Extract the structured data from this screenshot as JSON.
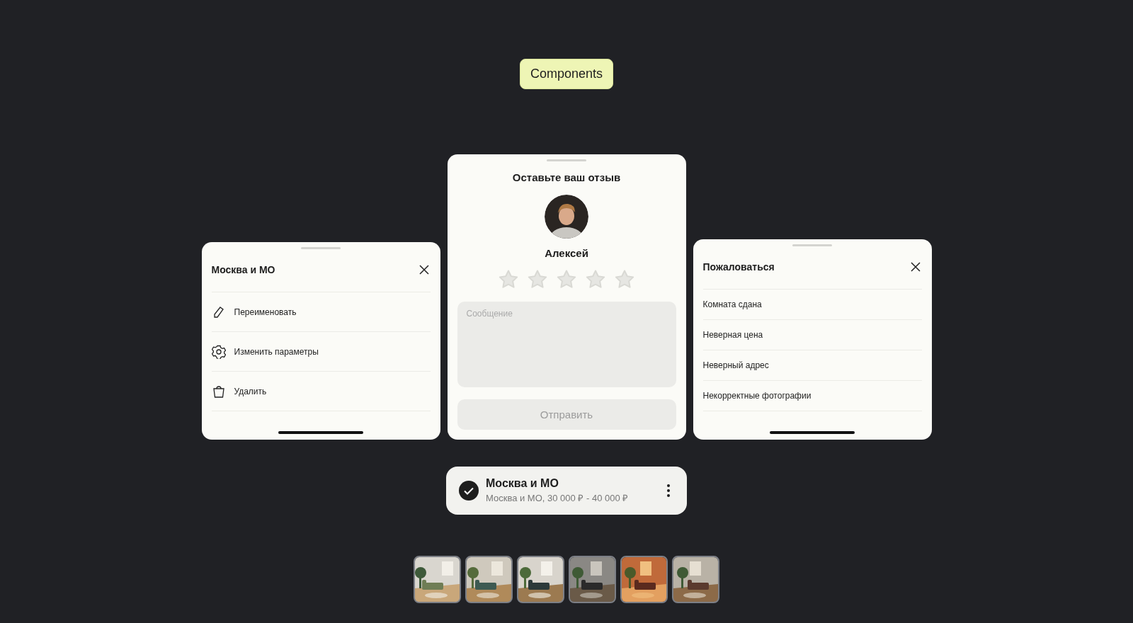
{
  "badge": {
    "label": "Components"
  },
  "menu_sheet": {
    "title": "Москва и МО",
    "items": [
      {
        "kind": "pencil",
        "label": "Переименовать"
      },
      {
        "kind": "gear",
        "label": "Изменить параметры"
      },
      {
        "kind": "trash",
        "label": "Удалить"
      }
    ]
  },
  "review_sheet": {
    "title": "Оставьте ваш отзыв",
    "name": "Алексей",
    "stars": 0,
    "message": {
      "placeholder": "Сообщение"
    },
    "submit": {
      "label": "Отправить",
      "disabled": true
    }
  },
  "report_sheet": {
    "title": "Пожаловаться",
    "items": [
      "Комната сдана",
      "Неверная цена",
      "Неверный адрес",
      "Некорректные фотографии"
    ]
  },
  "saved_search": {
    "checked": true,
    "title": "Москва и МО",
    "subtitle": "Москва и МО, 30 000 ₽ - 40 000 ₽"
  }
}
